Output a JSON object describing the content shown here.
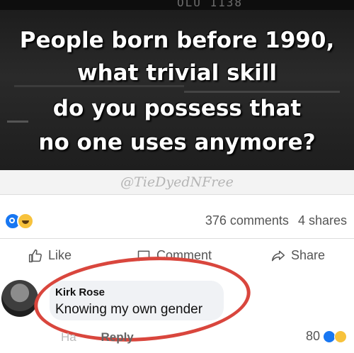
{
  "meme": {
    "stereo_display": "OLU  1138",
    "lines": [
      "People born before 1990,",
      "what trivial skill",
      "do you possess that",
      "no one uses anymore?"
    ]
  },
  "watermark": "@TieDyedNFree",
  "post_stats": {
    "comments": "376 comments",
    "shares": "4 shares"
  },
  "actions": {
    "like": "Like",
    "comment": "Comment",
    "share": "Share"
  },
  "comment": {
    "author": "Kirk Rose",
    "text": "Knowing my own gender",
    "ha_fragment": "Ha",
    "reply": "Reply",
    "reaction_count": "80"
  },
  "colors": {
    "meme_bg": "#222222",
    "like_blue": "#1877f2",
    "haha_yellow": "#f7c23c",
    "circle_red": "#d9463d",
    "bubble_bg": "#f0f2f5"
  },
  "icons": [
    "like-reaction-icon",
    "haha-reaction-icon",
    "thumbs-up-icon",
    "comment-icon",
    "share-icon"
  ]
}
